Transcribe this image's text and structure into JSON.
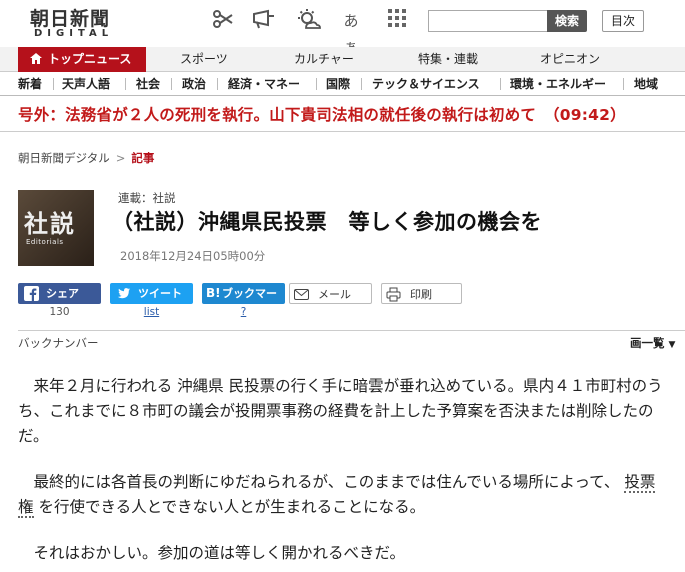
{
  "header": {
    "logo_jp": "朝日新聞",
    "logo_en": "DIGITAL",
    "icons": [
      "scissors-icon",
      "megaphone-icon",
      "weather-icon",
      "text-size-icon",
      "apps-grid-icon"
    ],
    "text_size_label": "あぁ",
    "search_button": "検索",
    "toc_button": "目次"
  },
  "nav_primary": [
    {
      "label": "トップニュース",
      "active": true
    },
    {
      "label": "スポーツ"
    },
    {
      "label": "カルチャー"
    },
    {
      "label": "特集・連載"
    },
    {
      "label": "オピニオン"
    }
  ],
  "nav_secondary": [
    "新着",
    "天声人語",
    "社会",
    "政治",
    "経済・マネー",
    "国際",
    "テック＆サイエンス",
    "環境・エネルギー",
    "地域"
  ],
  "breaking": "号外：法務省が２人の死刑を執行。山下貴司法相の就任後の執行は初めて　（09:42）",
  "breadcrumb": {
    "root": "朝日新聞デジタル",
    "chevron": ">",
    "current": "記事"
  },
  "article": {
    "thumb_kanji": "社説",
    "thumb_en": "Editorials",
    "series": "連載：社説",
    "title": "（社説）沖縄県民投票　等しく参加の機会を",
    "date": "2018年12月24日05時00分"
  },
  "share": {
    "facebook": "シェア",
    "facebook_count": "130",
    "twitter": "ツイート",
    "twitter_count": "list",
    "hatena": "ブックマーク",
    "hatena_count": "?",
    "mail": "メール",
    "print": "印刷",
    "colors": {
      "facebook": "#3b5998",
      "twitter": "#1da1f2",
      "hatena": "#1e88d0"
    }
  },
  "backnumber": {
    "label": "バックナンバー",
    "list": "画一覧"
  },
  "body": {
    "p1a": "　来年２月に行われる",
    "p1_link": "沖縄県",
    "p1b": "民投票の行く手に暗雲が垂れ込めている。県内４１市町村のうち、これまでに８市町の議会が投開票事務の経費を計上した予算案を否決または削除したのだ。",
    "p2a": "　最終的には各首長の判断にゆだねられるが、このままでは住んでいる場所によって、",
    "p2_link": "投票権",
    "p2b": "を行使できる人とできない人とが生まれることになる。",
    "p3": "　それはおかしい。参加の道は等しく開かれるべきだ。"
  }
}
